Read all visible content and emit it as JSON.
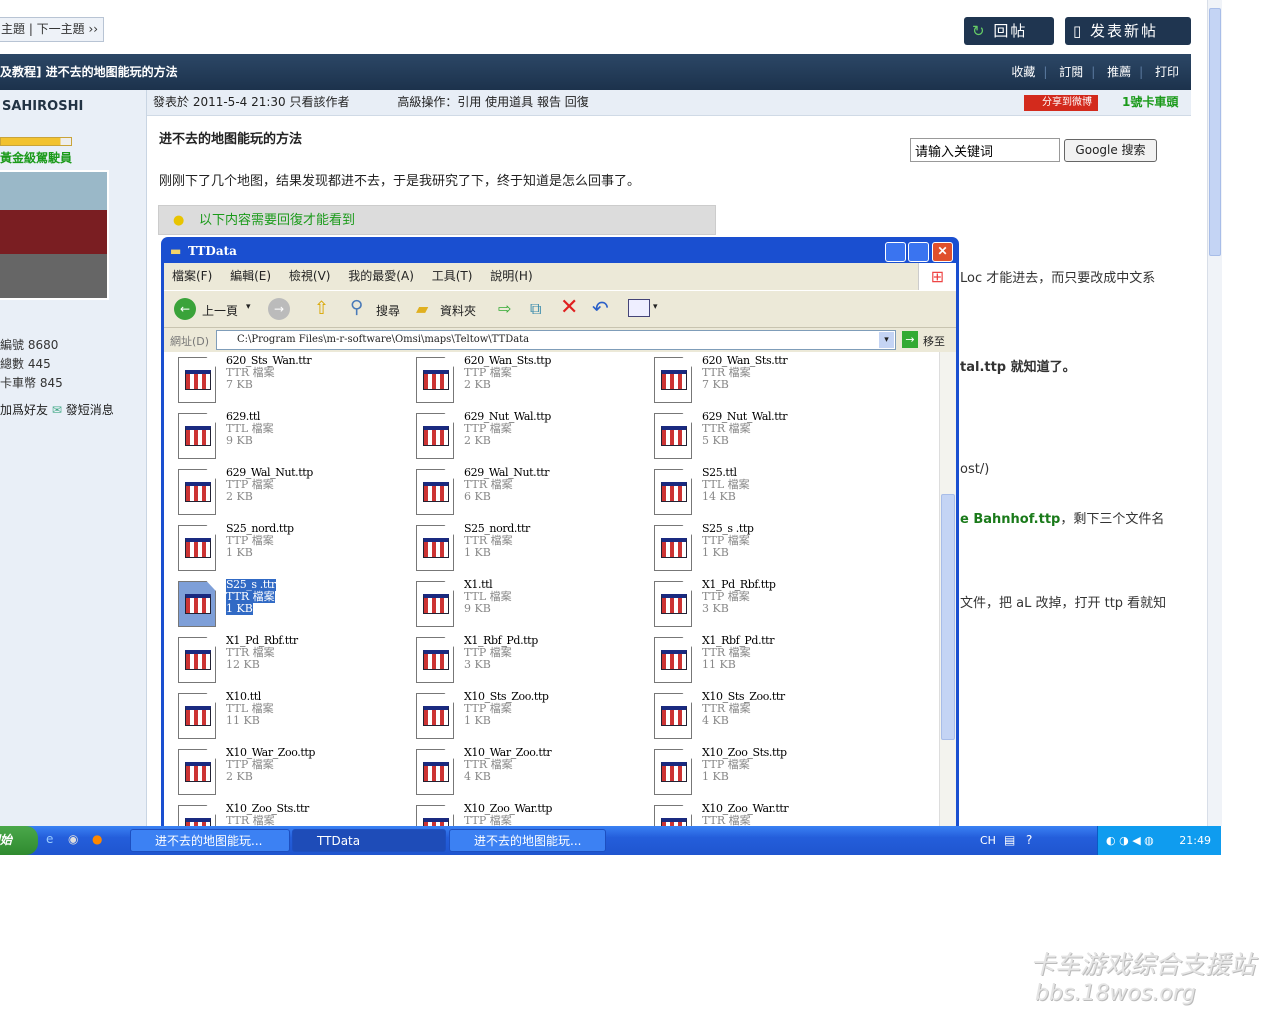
{
  "forum": {
    "nav": "主題 | 下一主題 ››",
    "reply_btn": "回帖",
    "new_btn": "发表新帖",
    "thread_title": "及教程] 进不去的地图能玩的方法",
    "actions": [
      "收藏",
      "訂閱",
      "推薦",
      "打印"
    ],
    "author": "SAHIROSHI",
    "rank": "黃金級駕駛員",
    "stats": [
      "編號  8680",
      "總數  445",
      "卡車幣  845"
    ],
    "add_friend": "加爲好友",
    "send_msg": "發短消息",
    "post_meta": "發表於 2011-5-4 21:30 只看該作者",
    "ops": "高級操作：引用 使用道具 報告 回復",
    "share": "分享到微博",
    "floor": "1號卡車頭",
    "post_title": "进不去的地图能玩的方法",
    "post_p1": "刚刚下了几个地图，结果发现都进不去，于是我研究了下，终于知道是怎么回事了。",
    "hidden_notice": "以下内容需要回復才能看到",
    "search_placeholder": "请输入关键词",
    "search_btn": "Google 搜索",
    "fragments": [
      "Loc 才能进去，而只要改成中文系",
      "tal.ttp 就知道了。",
      "ost/)",
      "e Bahnhof.ttp",
      "，剩下三个文件名",
      "文件，把 aL 改掉，打开 ttp 看就知"
    ]
  },
  "explorer": {
    "title": "TTData",
    "menu": [
      "檔案(F)",
      "編輯(E)",
      "檢視(V)",
      "我的最愛(A)",
      "工具(T)",
      "說明(H)"
    ],
    "back": "上一頁",
    "search": "搜尋",
    "folders": "資料夾",
    "address_label": "網址(D)",
    "address": "C:\\Program Files\\m-r-software\\Omsi\\maps\\Teltow\\TTData",
    "go": "移至",
    "files": [
      {
        "name": "620_Sts_Wan.ttr",
        "type": "TTR 檔案",
        "size": "7 KB"
      },
      {
        "name": "620_Wan_Sts.ttp",
        "type": "TTP 檔案",
        "size": "2 KB"
      },
      {
        "name": "620_Wan_Sts.ttr",
        "type": "TTR 檔案",
        "size": "7 KB"
      },
      {
        "name": "629.ttl",
        "type": "TTL 檔案",
        "size": "9 KB"
      },
      {
        "name": "629_Nut_Wal.ttp",
        "type": "TTP 檔案",
        "size": "2 KB"
      },
      {
        "name": "629_Nut_Wal.ttr",
        "type": "TTR 檔案",
        "size": "5 KB"
      },
      {
        "name": "629_Wal_Nut.ttp",
        "type": "TTP 檔案",
        "size": "2 KB"
      },
      {
        "name": "629_Wal_Nut.ttr",
        "type": "TTR 檔案",
        "size": "6 KB"
      },
      {
        "name": "S25.ttl",
        "type": "TTL 檔案",
        "size": "14 KB"
      },
      {
        "name": "S25_nord.ttp",
        "type": "TTP 檔案",
        "size": "1 KB"
      },
      {
        "name": "S25_nord.ttr",
        "type": "TTR 檔案",
        "size": "1 KB"
      },
      {
        "name": "S25_s   .ttp",
        "type": "TTP 檔案",
        "size": "1 KB"
      },
      {
        "name": "S25_s   .ttr",
        "type": "TTR 檔案",
        "size": "1 KB",
        "selected": true
      },
      {
        "name": "X1.ttl",
        "type": "TTL 檔案",
        "size": "9 KB"
      },
      {
        "name": "X1_Pd_Rbf.ttp",
        "type": "TTP 檔案",
        "size": "3 KB"
      },
      {
        "name": "X1_Pd_Rbf.ttr",
        "type": "TTR 檔案",
        "size": "12 KB"
      },
      {
        "name": "X1_Rbf_Pd.ttp",
        "type": "TTP 檔案",
        "size": "3 KB"
      },
      {
        "name": "X1_Rbf_Pd.ttr",
        "type": "TTR 檔案",
        "size": "11 KB"
      },
      {
        "name": "X10.ttl",
        "type": "TTL 檔案",
        "size": "11 KB"
      },
      {
        "name": "X10_Sts_Zoo.ttp",
        "type": "TTP 檔案",
        "size": "1 KB"
      },
      {
        "name": "X10_Sts_Zoo.ttr",
        "type": "TTR 檔案",
        "size": "4 KB"
      },
      {
        "name": "X10_War_Zoo.ttp",
        "type": "TTP 檔案",
        "size": "2 KB"
      },
      {
        "name": "X10_War_Zoo.ttr",
        "type": "TTR 檔案",
        "size": "4 KB"
      },
      {
        "name": "X10_Zoo_Sts.ttp",
        "type": "TTP 檔案",
        "size": "1 KB"
      },
      {
        "name": "X10_Zoo_Sts.ttr",
        "type": "TTR 檔案",
        "size": "",
        "partial": true
      },
      {
        "name": "X10_Zoo_War.ttp",
        "type": "TTP 檔案",
        "size": "",
        "partial": true
      },
      {
        "name": "X10_Zoo_War.ttr",
        "type": "TTR 檔案",
        "size": "",
        "partial": true
      }
    ]
  },
  "taskbar": {
    "start": "開始",
    "tasks": [
      "进不去的地图能玩...",
      "TTData",
      "进不去的地图能玩..."
    ],
    "lang": "CH",
    "clock": "21:49"
  },
  "watermark": [
    "卡车游戏综合支援站",
    "bbs.18wos.org"
  ]
}
